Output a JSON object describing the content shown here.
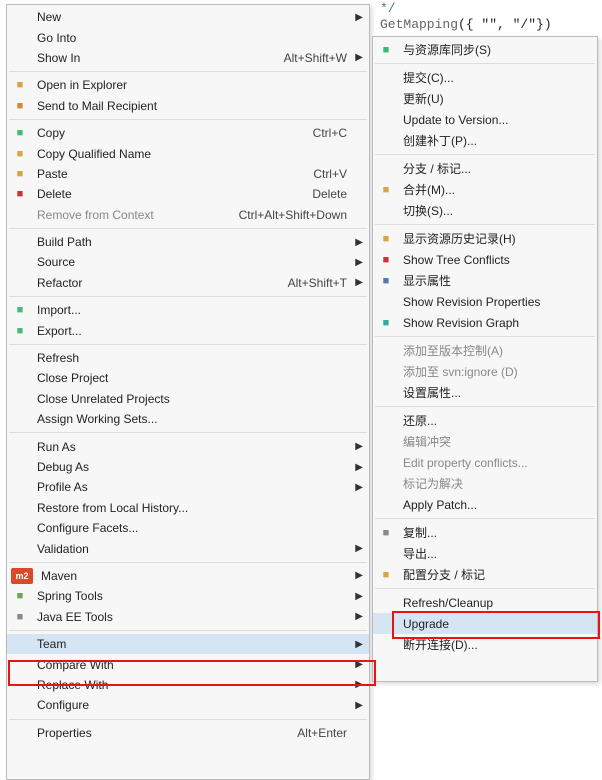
{
  "code": {
    "l1": "*/",
    "l2_pre": "GetMapping",
    "l2_rest": "({ \"\", \"/\"})"
  },
  "main": {
    "groups": [
      [
        {
          "id": "new",
          "label": "New",
          "sub": true
        },
        {
          "id": "gointo",
          "label": "Go Into"
        },
        {
          "id": "showin",
          "label": "Show In",
          "accel": "Alt+Shift+W",
          "sub": true
        }
      ],
      [
        {
          "id": "openexplorer",
          "label": "Open in Explorer",
          "icon": "ico-folder"
        },
        {
          "id": "sendmail",
          "label": "Send to Mail Recipient",
          "icon": "ico-mail"
        }
      ],
      [
        {
          "id": "copy",
          "label": "Copy",
          "accel": "Ctrl+C",
          "icon": "ico-copy"
        },
        {
          "id": "copyqn",
          "label": "Copy Qualified Name",
          "icon": "ico-copy2"
        },
        {
          "id": "paste",
          "label": "Paste",
          "accel": "Ctrl+V",
          "icon": "ico-paste"
        },
        {
          "id": "delete",
          "label": "Delete",
          "accel": "Delete",
          "icon": "ico-del"
        },
        {
          "id": "removectx",
          "label": "Remove from Context",
          "accel": "Ctrl+Alt+Shift+Down",
          "dim": true
        }
      ],
      [
        {
          "id": "buildpath",
          "label": "Build Path",
          "sub": true
        },
        {
          "id": "source",
          "label": "Source",
          "sub": true
        },
        {
          "id": "refactor",
          "label": "Refactor",
          "accel": "Alt+Shift+T",
          "sub": true
        }
      ],
      [
        {
          "id": "import",
          "label": "Import...",
          "icon": "ico-import"
        },
        {
          "id": "export",
          "label": "Export...",
          "icon": "ico-export"
        }
      ],
      [
        {
          "id": "refresh",
          "label": "Refresh"
        },
        {
          "id": "closeproj",
          "label": "Close Project"
        },
        {
          "id": "closeunrel",
          "label": "Close Unrelated Projects"
        },
        {
          "id": "assignws",
          "label": "Assign Working Sets..."
        }
      ],
      [
        {
          "id": "runas",
          "label": "Run As",
          "sub": true
        },
        {
          "id": "debugas",
          "label": "Debug As",
          "sub": true
        },
        {
          "id": "profileas",
          "label": "Profile As",
          "sub": true
        },
        {
          "id": "restorehist",
          "label": "Restore from Local History..."
        },
        {
          "id": "configfacets",
          "label": "Configure Facets..."
        },
        {
          "id": "validation",
          "label": "Validation",
          "sub": true
        }
      ],
      [
        {
          "id": "maven",
          "label": "Maven",
          "icon": "ico-m2",
          "sub": true
        },
        {
          "id": "spring",
          "label": "Spring Tools",
          "icon": "ico-spring",
          "sub": true
        },
        {
          "id": "javaeetools",
          "label": "Java EE Tools",
          "icon": "ico-java",
          "sub": true
        }
      ],
      [
        {
          "id": "team",
          "label": "Team",
          "sub": true,
          "hov": true
        },
        {
          "id": "comparewith",
          "label": "Compare With",
          "sub": true
        },
        {
          "id": "replacewith",
          "label": "Replace With",
          "sub": true
        },
        {
          "id": "configure",
          "label": "Configure",
          "sub": true
        }
      ],
      [
        {
          "id": "properties",
          "label": "Properties",
          "accel": "Alt+Enter"
        }
      ]
    ]
  },
  "sub": {
    "groups": [
      [
        {
          "id": "syncrepo",
          "label": "与资源库同步(S)",
          "icon": "ico-sync"
        }
      ],
      [
        {
          "id": "commit",
          "label": "提交(C)..."
        },
        {
          "id": "update",
          "label": "更新(U)"
        },
        {
          "id": "updtover",
          "label": "Update to Version..."
        },
        {
          "id": "createpatch",
          "label": "创建补丁(P)..."
        }
      ],
      [
        {
          "id": "branchtag",
          "label": "分支 / 标记..."
        },
        {
          "id": "merge",
          "label": "合并(M)...",
          "icon": "ico-merge"
        },
        {
          "id": "switch",
          "label": "切换(S)..."
        }
      ],
      [
        {
          "id": "showhist",
          "label": "显示资源历史记录(H)",
          "icon": "ico-hist"
        },
        {
          "id": "treeconf",
          "label": "Show Tree Conflicts",
          "icon": "ico-tree"
        },
        {
          "id": "showprops",
          "label": "显示属性",
          "icon": "ico-prop"
        },
        {
          "id": "revprops",
          "label": "Show Revision Properties"
        },
        {
          "id": "revgraph",
          "label": "Show Revision Graph",
          "icon": "ico-graph"
        }
      ],
      [
        {
          "id": "addvc",
          "label": "添加至版本控制(A)",
          "dim": true
        },
        {
          "id": "svnignore",
          "label": "添加至 svn:ignore (D)",
          "dim": true
        },
        {
          "id": "setprop",
          "label": "设置属性..."
        }
      ],
      [
        {
          "id": "revert",
          "label": "还原..."
        },
        {
          "id": "editconf",
          "label": "编辑冲突",
          "dim": true
        },
        {
          "id": "editpropconf",
          "label": "Edit property conflicts...",
          "dim": true
        },
        {
          "id": "markresolved",
          "label": "标记为解决",
          "dim": true
        },
        {
          "id": "applypatch",
          "label": "Apply Patch..."
        }
      ],
      [
        {
          "id": "copyto",
          "label": "复制...",
          "icon": "ico-copy3"
        },
        {
          "id": "exportsub",
          "label": "导出..."
        },
        {
          "id": "cfgbranch",
          "label": "配置分支 / 标记",
          "icon": "ico-cfg"
        }
      ],
      [
        {
          "id": "refreshclean",
          "label": "Refresh/Cleanup"
        },
        {
          "id": "upgrade",
          "label": "Upgrade",
          "hov": true
        },
        {
          "id": "disconnect",
          "label": "断开连接(D)..."
        }
      ]
    ]
  }
}
